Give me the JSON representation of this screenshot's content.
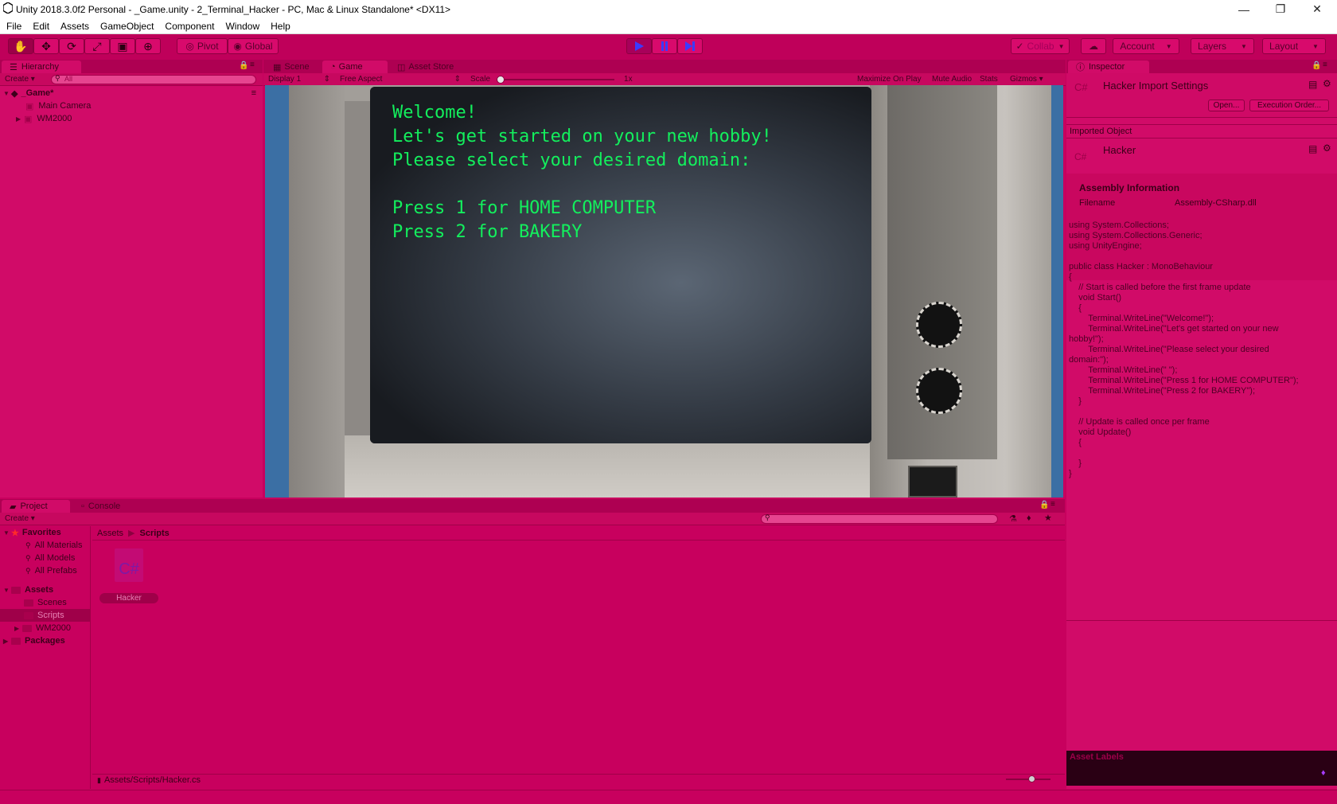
{
  "window": {
    "title": "Unity 2018.3.0f2 Personal - _Game.unity - 2_Terminal_Hacker - PC, Mac & Linux Standalone* <DX11>"
  },
  "menu": [
    "File",
    "Edit",
    "Assets",
    "GameObject",
    "Component",
    "Window",
    "Help"
  ],
  "toolbar": {
    "pivot": "Pivot",
    "global": "Global",
    "collab": "Collab",
    "account": "Account",
    "layers": "Layers",
    "layout": "Layout"
  },
  "hierarchy": {
    "tab": "Hierarchy",
    "create": "Create",
    "search_placeholder": "All",
    "scene": "_Game*",
    "items": [
      "Main Camera",
      "WM2000"
    ]
  },
  "sceneview": {
    "tabs": [
      "Scene",
      "Game",
      "Asset Store"
    ],
    "display": "Display 1",
    "aspect": "Free Aspect",
    "scale_label": "Scale",
    "scale_value": "1x",
    "options": [
      "Maximize On Play",
      "Mute Audio",
      "Stats",
      "Gizmos"
    ]
  },
  "terminal": {
    "lines": [
      "Welcome!",
      "Let's get started on your new hobby!",
      "Please select your desired domain:",
      "",
      "Press 1 for HOME COMPUTER",
      "Press 2 for BAKERY"
    ]
  },
  "inspector": {
    "tab": "Inspector",
    "import_settings": "Hacker Import Settings",
    "open_btn": "Open...",
    "exec_order_btn": "Execution Order...",
    "imported_object": "Imported Object",
    "object_name": "Hacker",
    "csharp_label": "C#",
    "assembly_header": "Assembly Information",
    "filename_label": "Filename",
    "filename_value": "Assembly-CSharp.dll",
    "code": "using System.Collections;\nusing System.Collections.Generic;\nusing UnityEngine;\n\npublic class Hacker : MonoBehaviour\n{\n    // Start is called before the first frame update\n    void Start()\n    {\n        Terminal.WriteLine(\"Welcome!\");\n        Terminal.WriteLine(\"Let's get started on your new\nhobby!\");\n        Terminal.WriteLine(\"Please select your desired\ndomain:\");\n        Terminal.WriteLine(\" \");\n        Terminal.WriteLine(\"Press 1 for HOME COMPUTER\");\n        Terminal.WriteLine(\"Press 2 for BAKERY\");\n    }\n\n    // Update is called once per frame\n    void Update()\n    {\n\n    }\n}",
    "asset_labels": "Asset Labels"
  },
  "project": {
    "tabs": [
      "Project",
      "Console"
    ],
    "create": "Create",
    "favorites": "Favorites",
    "favorite_items": [
      "All Materials",
      "All Models",
      "All Prefabs"
    ],
    "assets": "Assets",
    "asset_folders": [
      "Scenes",
      "Scripts",
      "WM2000"
    ],
    "packages": "Packages",
    "breadcrumb": [
      "Assets",
      "Scripts"
    ],
    "file_name": "Hacker",
    "file_icon_text": "C#",
    "status_path": "Assets/Scripts/Hacker.cs"
  }
}
